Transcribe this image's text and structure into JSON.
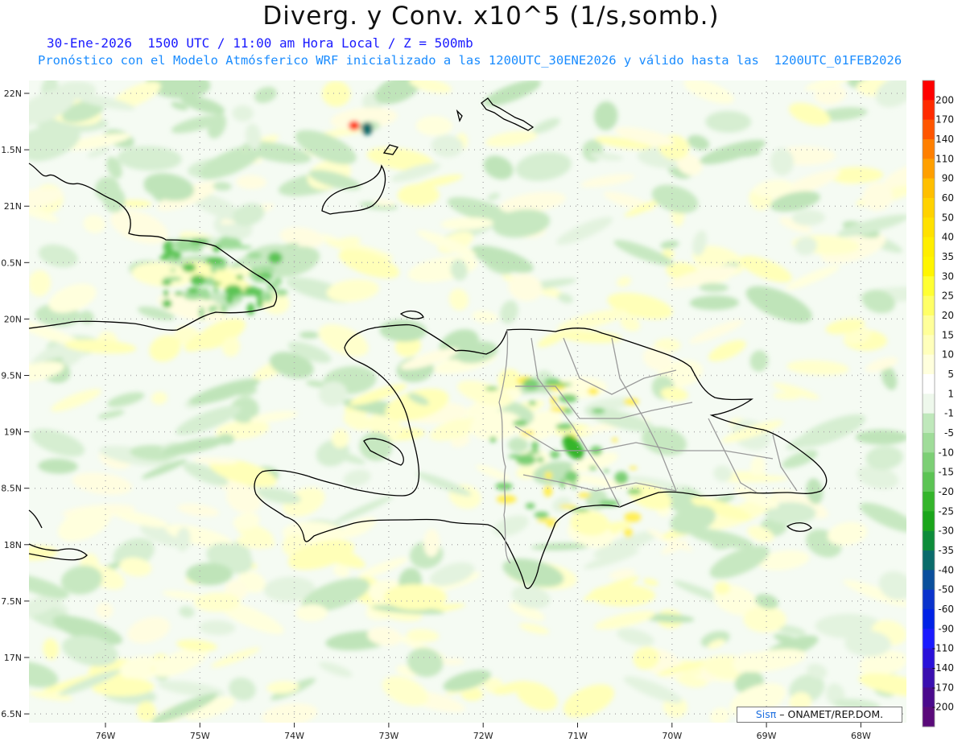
{
  "header": {
    "title": "Diverg. y Conv. x10^5 (1/s,somb.)",
    "subtitle1": "30-Ene-2026  1500 UTC / 11:00 am Hora Local / Z = 500mb",
    "subtitle2": "Pronóstico con el Modelo Atmósferico WRF inicializado a las 1200UTC_30ENE2026 y válido hasta las  1200UTC_01FEB2026"
  },
  "axes": {
    "lat_labels": [
      "22N",
      "1.5N",
      "21N",
      "0.5N",
      "20N",
      "9.5N",
      "19N",
      "8.5N",
      "18N",
      "7.5N",
      "17N",
      "6.5N"
    ],
    "lon_labels": [
      "76W",
      "75W",
      "74W",
      "73W",
      "72W",
      "71W",
      "70W",
      "69W",
      "68W"
    ]
  },
  "colorbar": {
    "levels": [
      "200",
      "170",
      "140",
      "110",
      "90",
      "60",
      "50",
      "40",
      "35",
      "30",
      "25",
      "20",
      "15",
      "10",
      "5",
      "1",
      "-1",
      "-5",
      "-10",
      "-15",
      "-20",
      "-25",
      "-30",
      "-35",
      "-40",
      "-50",
      "-60",
      "-90",
      "-110",
      "-140",
      "-170",
      "-200"
    ],
    "colors": [
      "#ff0000",
      "#ff2a00",
      "#ff5500",
      "#ff7f00",
      "#ff9f00",
      "#ffbf00",
      "#ffd200",
      "#ffe100",
      "#ffee00",
      "#fff500",
      "#ffff33",
      "#ffff66",
      "#ffff99",
      "#ffffbb",
      "#ffffdd",
      "#ffffff",
      "#eef8ec",
      "#bfe8bb",
      "#9fdc99",
      "#7ccf75",
      "#5cc454",
      "#34b52b",
      "#1aa51a",
      "#0d8c3a",
      "#0a6b6b",
      "#0a4f9c",
      "#0a33cc",
      "#0022e6",
      "#1a1aff",
      "#2a11d9",
      "#3a0fb0",
      "#4a0a8c",
      "#5a0a7a"
    ]
  },
  "credit": {
    "logo": "Sisπ",
    "text": " – ONAMET/REP.DOM."
  }
}
